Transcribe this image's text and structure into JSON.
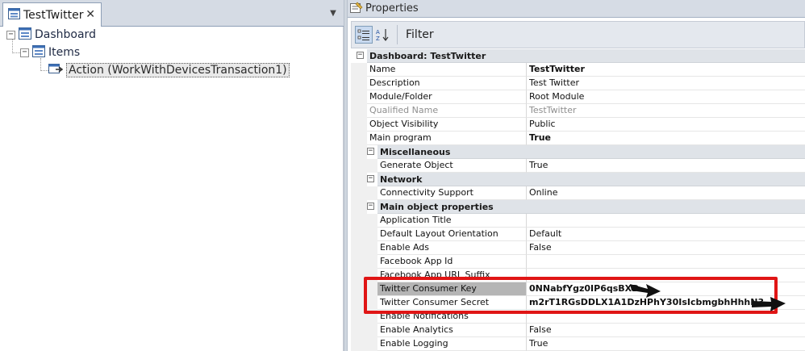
{
  "left_panel": {
    "tab_title": "TestTwitter",
    "tree": {
      "root": "Dashboard",
      "child": "Items",
      "leaf": "Action (WorkWithDevicesTransaction1)"
    }
  },
  "properties_panel": {
    "title": "Properties",
    "toolbar": {
      "filter_label": "Filter"
    },
    "category_main": "Dashboard: TestTwitter",
    "rows_main": [
      {
        "name": "Name",
        "value": "TestTwitter"
      },
      {
        "name": "Description",
        "value": "Test Twitter"
      },
      {
        "name": "Module/Folder",
        "value": "Root Module"
      },
      {
        "name": "Qualified Name",
        "value": "TestTwitter"
      },
      {
        "name": "Object Visibility",
        "value": "Public"
      },
      {
        "name": "Main program",
        "value": "True"
      }
    ],
    "cat_misc": "Miscellaneous",
    "rows_misc": [
      {
        "name": "Generate Object",
        "value": "True"
      }
    ],
    "cat_network": "Network",
    "rows_network": [
      {
        "name": "Connectivity Support",
        "value": "Online"
      }
    ],
    "cat_mop": "Main object properties",
    "rows_mop": [
      {
        "name": "Application Title",
        "value": ""
      },
      {
        "name": "Default Layout Orientation",
        "value": "Default"
      },
      {
        "name": "Enable Ads",
        "value": "False"
      },
      {
        "name": "Facebook App Id",
        "value": ""
      },
      {
        "name": "Facebook App URL Suffix",
        "value": ""
      },
      {
        "name": "Twitter Consumer Key",
        "value": "0NNabfYgz0IP6qsBXD"
      },
      {
        "name": "Twitter Consumer Secret",
        "value": "m2rT1RGsDDLX1A1DzHPhY30IsIcbmgbhHhhN3"
      },
      {
        "name": "Enable Notifications",
        "value": ""
      },
      {
        "name": "Enable Analytics",
        "value": "False"
      },
      {
        "name": "Enable Logging",
        "value": "True"
      }
    ]
  },
  "colors": {
    "highlight_border": "#e01515",
    "selected_row": "#b5b5b5",
    "category_bg": "#dfe3e8"
  }
}
